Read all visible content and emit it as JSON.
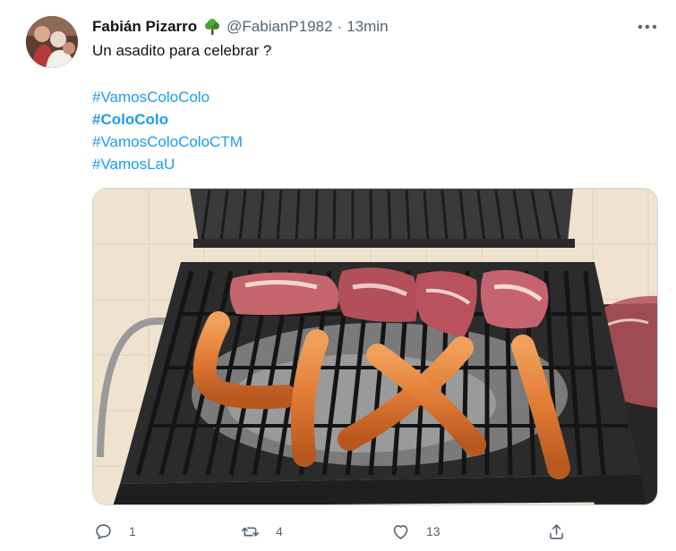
{
  "tweet": {
    "author": {
      "display_name": "Fabián Pizarro",
      "badge_icon": "tree-icon",
      "handle": "@FabianP1982",
      "separator": "·",
      "time": "13min"
    },
    "text": "Un asadito para celebrar ?",
    "hashtags": [
      {
        "text": "#VamosColoColo",
        "bold": false
      },
      {
        "text": "#ColoColo",
        "bold": true
      },
      {
        "text": "#VamosColoColoCTM",
        "bold": false
      },
      {
        "text": "#VamosLaU",
        "bold": false
      }
    ],
    "media": {
      "description_icon": "grill-photo"
    },
    "actions": {
      "reply": {
        "icon": "reply-icon",
        "count": "1"
      },
      "retweet": {
        "icon": "retweet-icon",
        "count": "4"
      },
      "like": {
        "icon": "heart-icon",
        "count": "13"
      },
      "share": {
        "icon": "share-icon"
      }
    },
    "colors": {
      "link": "#1d9bf0",
      "text": "#0f1419",
      "secondary": "#536471",
      "tree": "#3f8f2f"
    }
  }
}
